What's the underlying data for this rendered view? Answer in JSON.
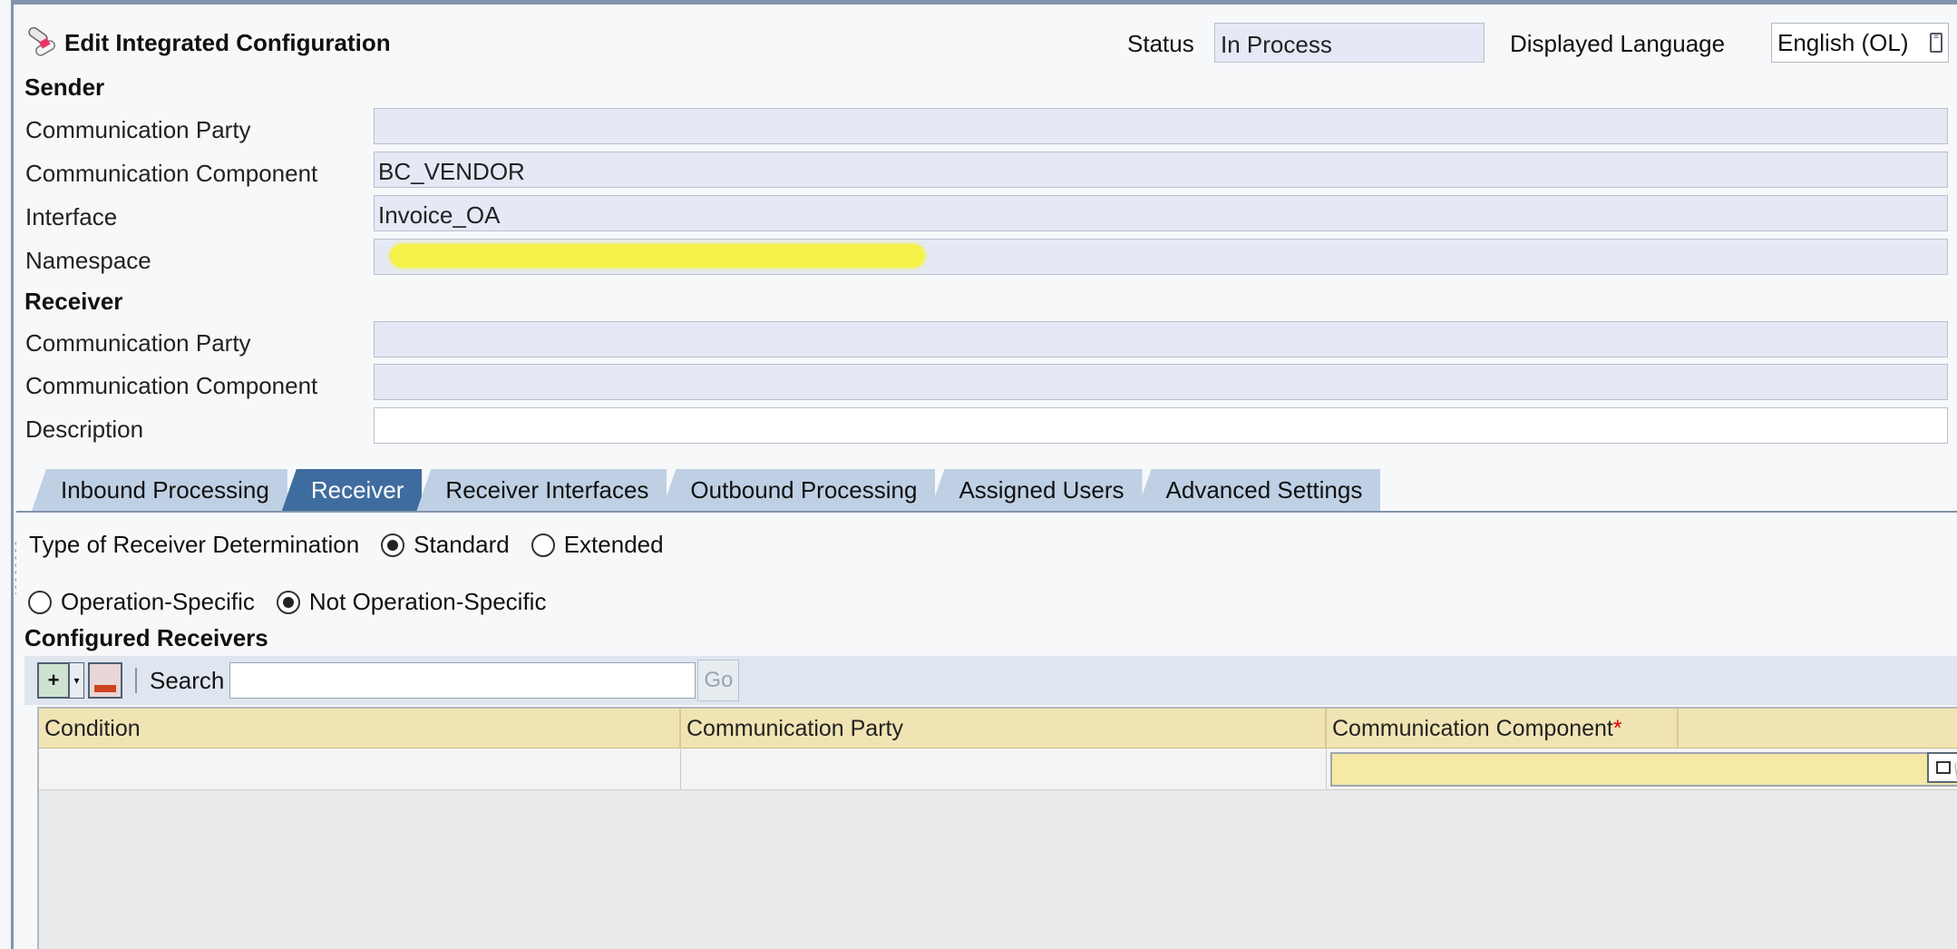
{
  "header": {
    "title": "Edit Integrated Configuration",
    "title_icon": "configuration-pills-icon",
    "status_label": "Status",
    "status_value": "In Process",
    "language_label": "Displayed Language",
    "language_value": "English (OL)"
  },
  "sender": {
    "heading": "Sender",
    "fields": [
      {
        "label": "Communication Party",
        "value": ""
      },
      {
        "label": "Communication Component",
        "value": "BC_VENDOR"
      },
      {
        "label": "Interface",
        "value": "Invoice_OA"
      },
      {
        "label": "Namespace",
        "value": ""
      }
    ]
  },
  "receiver": {
    "heading": "Receiver",
    "fields": [
      {
        "label": "Communication Party",
        "value": ""
      },
      {
        "label": "Communication Component",
        "value": ""
      },
      {
        "label": "Description",
        "value": ""
      }
    ]
  },
  "tabs": [
    {
      "label": "Inbound Processing",
      "active": false
    },
    {
      "label": "Receiver",
      "active": true
    },
    {
      "label": "Receiver Interfaces",
      "active": false
    },
    {
      "label": "Outbound Processing",
      "active": false
    },
    {
      "label": "Assigned Users",
      "active": false
    },
    {
      "label": "Advanced Settings",
      "active": false
    }
  ],
  "receiver_tab": {
    "determination_label": "Type of Receiver Determination",
    "standard_label": "Standard",
    "extended_label": "Extended",
    "determination_selected": "Standard",
    "operation_specific_label": "Operation-Specific",
    "not_operation_specific_label": "Not Operation-Specific",
    "operation_selected": "Not Operation-Specific",
    "configured_heading": "Configured Receivers",
    "toolbar": {
      "search_label": "Search",
      "search_value": "",
      "go_label": "Go"
    },
    "table": {
      "columns": [
        "Condition",
        "Communication Party",
        "Communication Component"
      ],
      "required_marker": "*",
      "rows": [
        {
          "condition": "",
          "party": "",
          "component": ""
        }
      ]
    }
  }
}
